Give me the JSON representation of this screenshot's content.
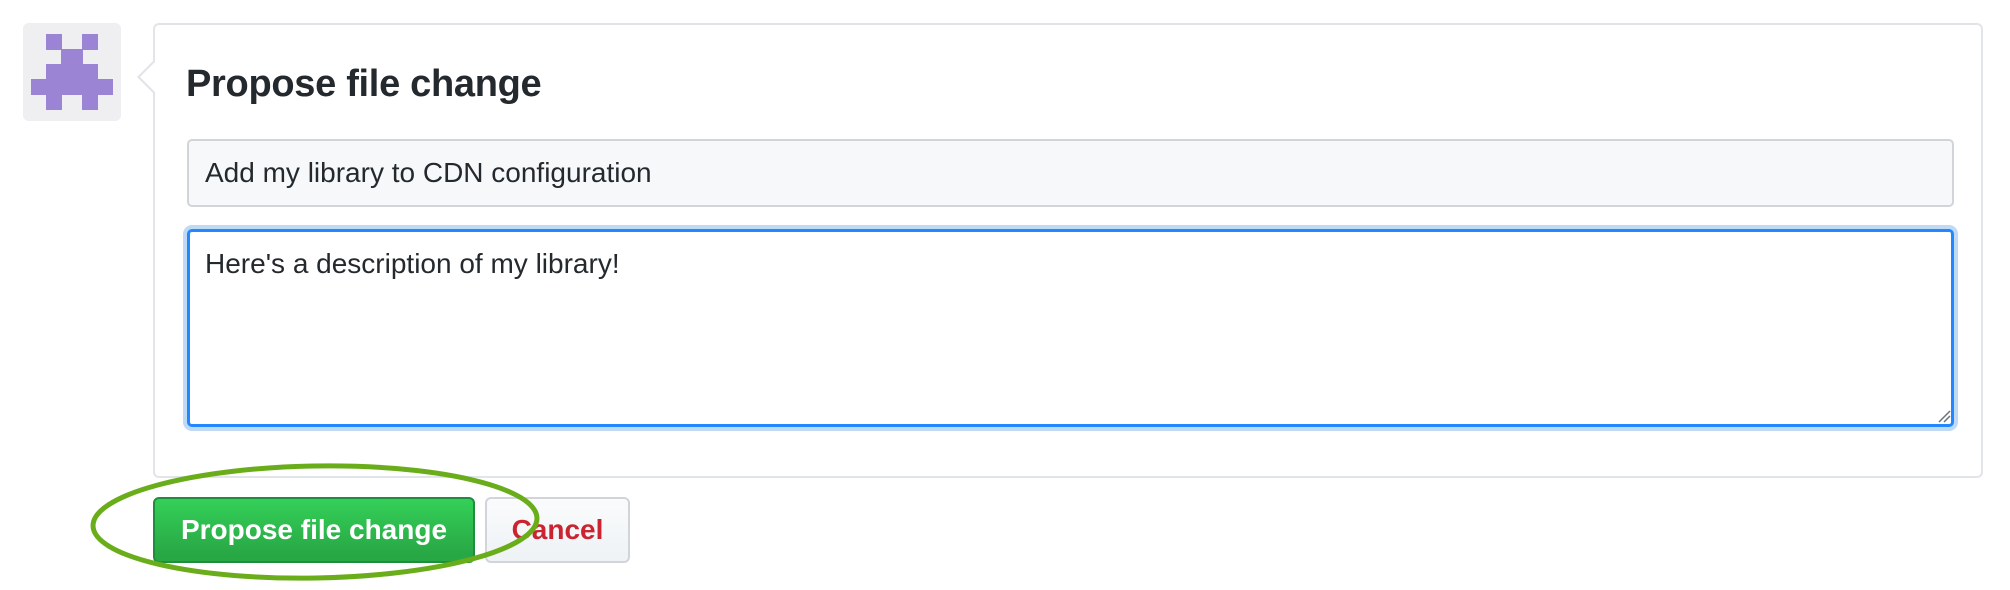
{
  "avatar": {
    "icon": "identicon",
    "color": "#9b84d4"
  },
  "form": {
    "title": "Propose file change",
    "summary_value": "Add my library to CDN configuration",
    "description_value": "Here's a description of my library!"
  },
  "buttons": {
    "propose_label": "Propose file change",
    "cancel_label": "Cancel"
  },
  "annotation": {
    "highlight_color": "#6aad1b",
    "target": "propose-button"
  },
  "colors": {
    "primary_green": "#2ea44f",
    "danger_red": "#cb2431",
    "focus_blue": "#2188ff"
  }
}
